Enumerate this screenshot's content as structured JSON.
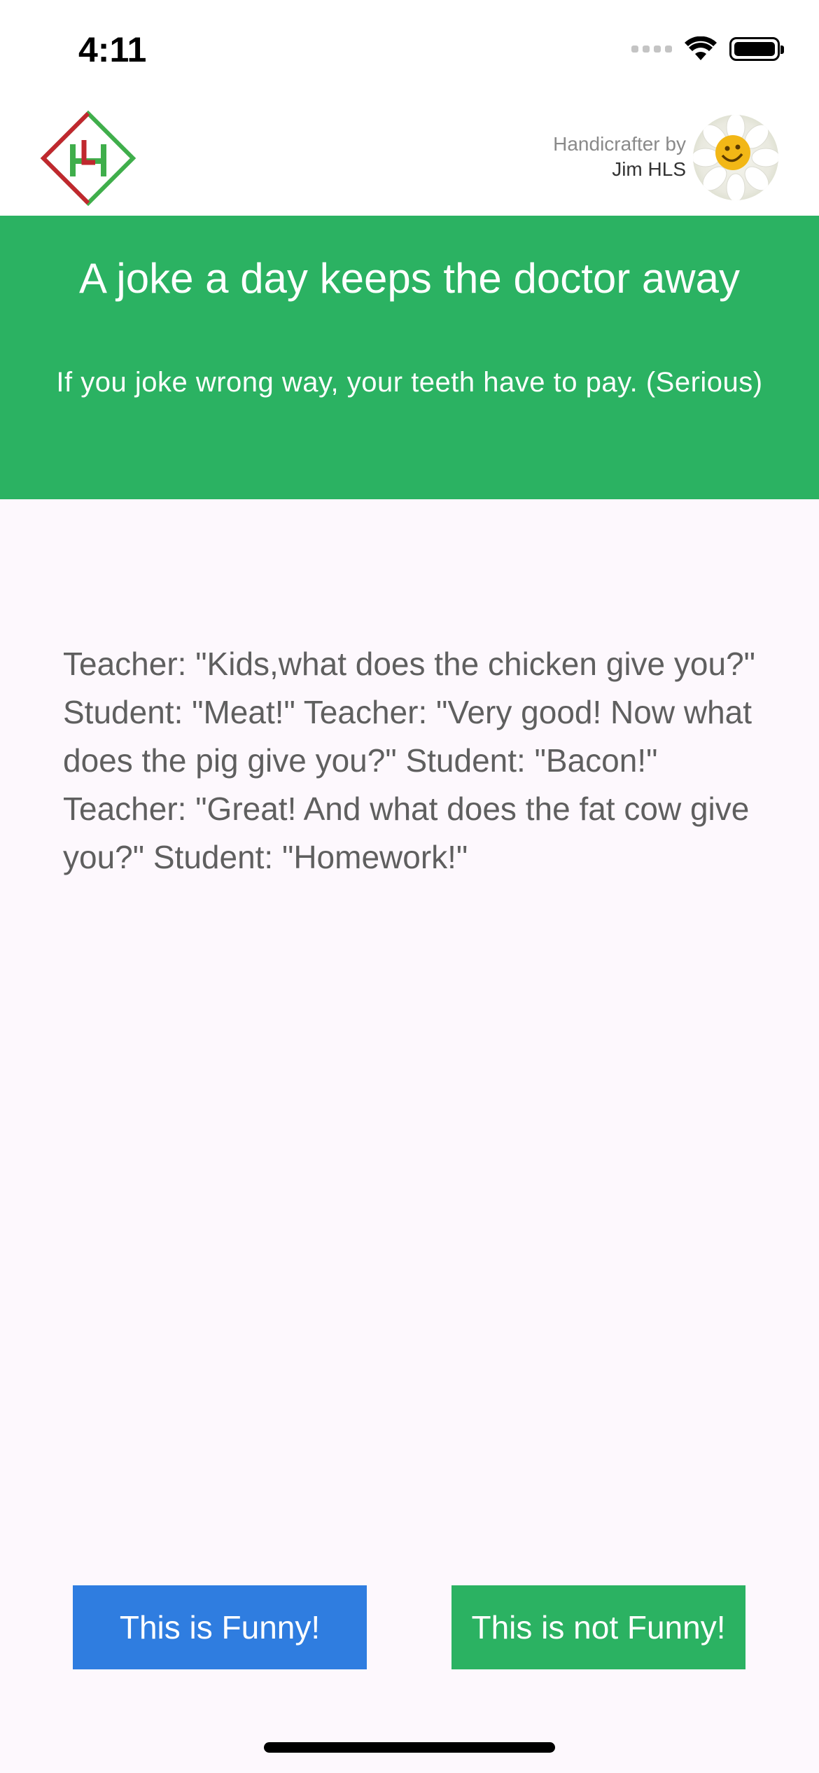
{
  "status_bar": {
    "time": "4:11"
  },
  "header": {
    "credit_line1": "Handicrafter by",
    "credit_line2": "Jim HLS"
  },
  "banner": {
    "title": "A joke a day keeps the doctor away",
    "subtitle": "If you joke wrong way, your teeth have to pay. (Serious)"
  },
  "joke": {
    "text": "Teacher: \"Kids,what does the chicken give you?\" Student: \"Meat!\" Teacher: \"Very good! Now what does the pig give you?\" Student: \"Bacon!\" Teacher: \"Great! And what does the fat cow give you?\" Student: \"Homework!\""
  },
  "buttons": {
    "funny": "This is Funny!",
    "not_funny": "This is not Funny!"
  },
  "colors": {
    "banner_green": "#2bb262",
    "funny_blue": "#2f7de0",
    "not_funny_green": "#2bb262",
    "body_bg": "#fdf8fd"
  },
  "icons": {
    "logo": "hl-diamond-logo",
    "avatar": "smiley-daisy-avatar",
    "signal": "cellular-signal-icon",
    "wifi": "wifi-icon",
    "battery": "battery-icon"
  }
}
